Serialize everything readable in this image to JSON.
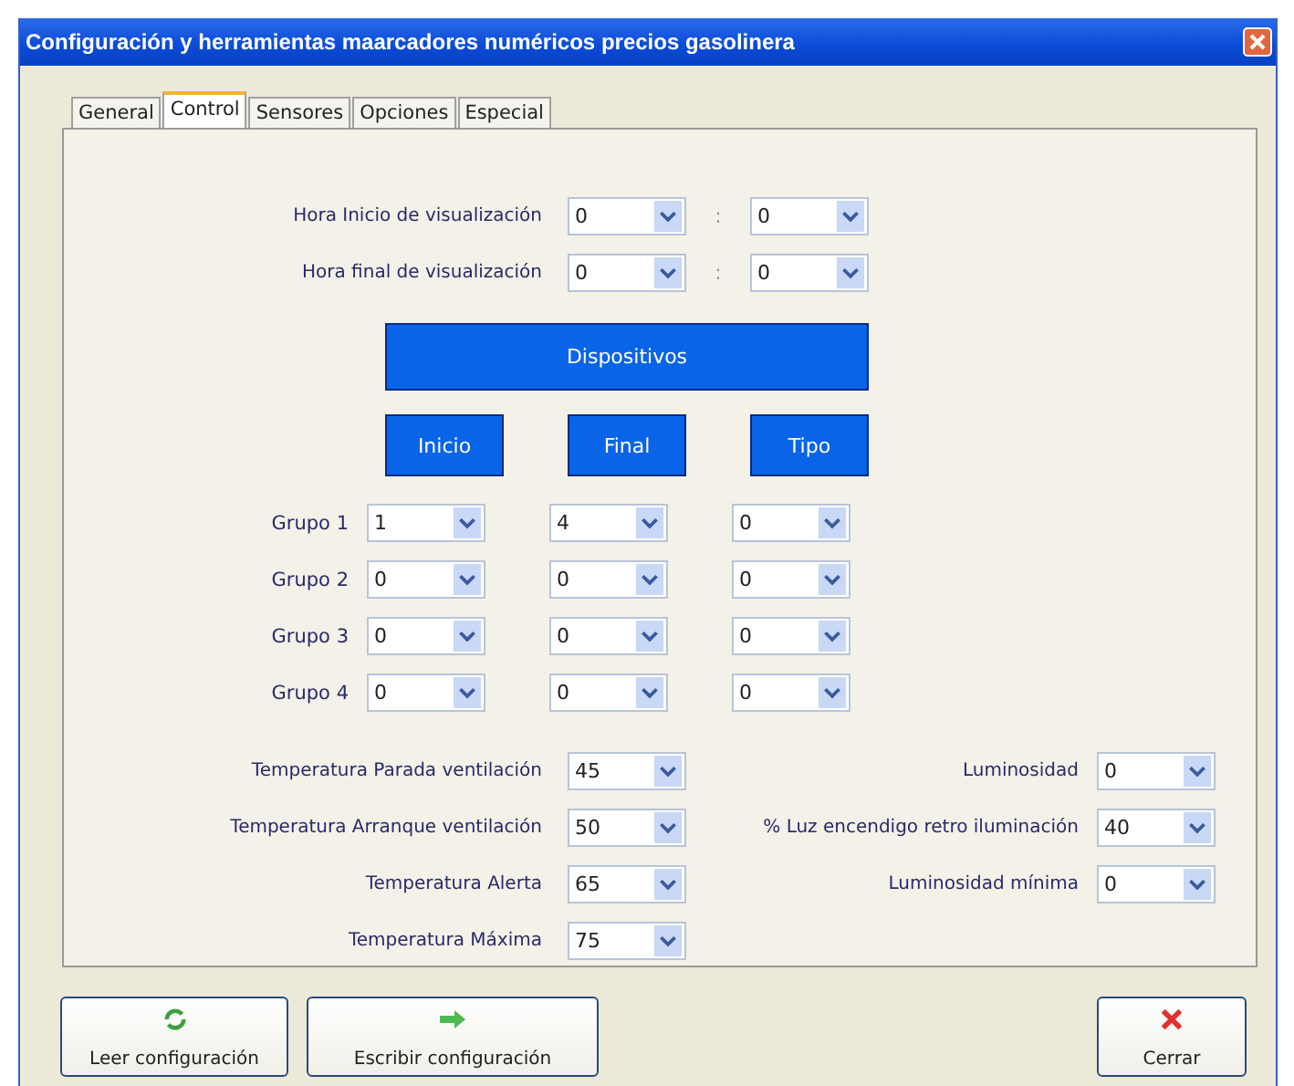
{
  "window": {
    "title": "Configuración y herramientas maarcadores numéricos precios gasolinera"
  },
  "tabs": [
    {
      "label": "General",
      "selected": false
    },
    {
      "label": "Control",
      "selected": true
    },
    {
      "label": "Sensores",
      "selected": false
    },
    {
      "label": "Opciones",
      "selected": false
    },
    {
      "label": "Especial",
      "selected": false
    }
  ],
  "display_hours": [
    {
      "label": "Hora Inicio de visualización",
      "hour": "0",
      "separator": ":",
      "minute": "0"
    },
    {
      "label": "Hora final de visualización",
      "hour": "0",
      "separator": ":",
      "minute": "0"
    }
  ],
  "devices": {
    "title": "Dispositivos",
    "columns": [
      "Inicio",
      "Final",
      "Tipo"
    ],
    "groups": [
      {
        "label": "Grupo 1",
        "values": [
          "1",
          "4",
          "0"
        ]
      },
      {
        "label": "Grupo 2",
        "values": [
          "0",
          "0",
          "0"
        ]
      },
      {
        "label": "Grupo 3",
        "values": [
          "0",
          "0",
          "0"
        ]
      },
      {
        "label": "Grupo 4",
        "values": [
          "0",
          "0",
          "0"
        ]
      }
    ]
  },
  "temperature": [
    {
      "label": "Temperatura Parada ventilación",
      "value": "45"
    },
    {
      "label": "Temperatura Arranque ventilación",
      "value": "50"
    },
    {
      "label": "Temperatura Alerta",
      "value": "65"
    },
    {
      "label": "Temperatura Máxima",
      "value": "75"
    }
  ],
  "lighting": [
    {
      "label": "Luminosidad",
      "value": "0"
    },
    {
      "label": "% Luz encendigo retro iluminación",
      "value": "40"
    },
    {
      "label": "Luminosidad mínima",
      "value": "0"
    }
  ],
  "buttons": [
    {
      "kind": "reload",
      "label": "Leer configuración"
    },
    {
      "kind": "write",
      "label": "Escribir configuración"
    },
    {
      "kind": "close",
      "label": "Cerrar"
    }
  ]
}
